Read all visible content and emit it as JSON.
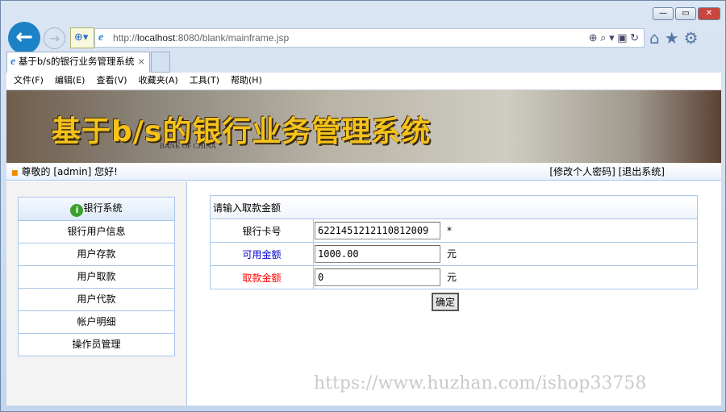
{
  "browser": {
    "url_prefix": "http://",
    "url_host": "localhost",
    "url_rest": ":8080/blank/mainframe.jsp",
    "tab_title": "基于b/s的银行业务管理系统",
    "tab_close": "×",
    "window_controls": [
      "—",
      "▭",
      "✕"
    ]
  },
  "menubar": [
    "文件(F)",
    "编辑(E)",
    "查看(V)",
    "收藏夹(A)",
    "工具(T)",
    "帮助(H)"
  ],
  "header": {
    "banner_title": "基于b/s的银行业务管理系统",
    "bank_text": "BANK OF CHINA",
    "greeting": "尊敬的 [admin] 您好!",
    "change_password": "[修改个人密码]",
    "logout": "[退出系统]"
  },
  "sidebar": {
    "heading": "银行系统",
    "items": [
      "银行用户信息",
      "用户存款",
      "用户取款",
      "用户代款",
      "帐户明细",
      "操作员管理"
    ]
  },
  "form": {
    "caption": "请输入取款金额",
    "card_label": "银行卡号",
    "card_value": "6221451212110812009",
    "required_mark": "*",
    "available_label": "可用金额",
    "available_value": "1000.00",
    "amount_label": "取款金额",
    "amount_value": "0",
    "unit": "元",
    "submit": "确定",
    "colors": {
      "available": "#0000cc",
      "amount": "#ff0000"
    }
  },
  "watermark": "https://www.huzhan.com/ishop33758"
}
